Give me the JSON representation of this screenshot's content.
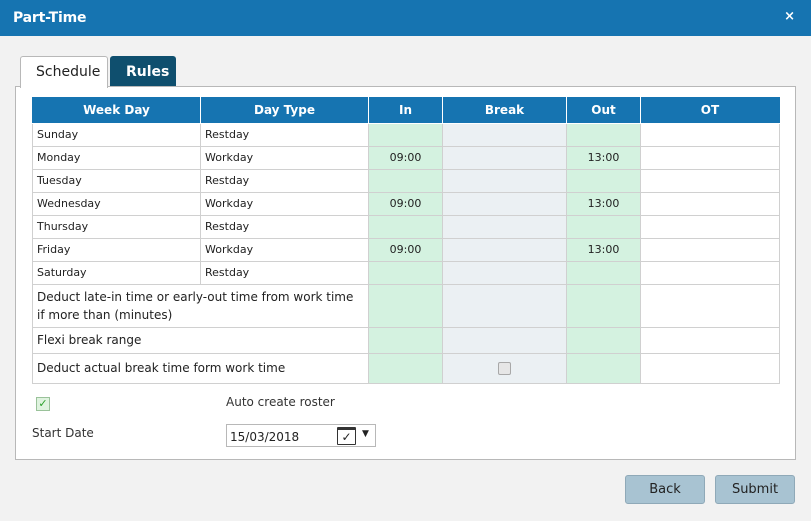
{
  "window": {
    "title": "Part-Time",
    "close_glyph": "×"
  },
  "tabs": [
    {
      "label": "Schedule",
      "active": true
    },
    {
      "label": "Rules",
      "active": false
    }
  ],
  "table": {
    "headers": [
      "Week Day",
      "Day Type",
      "In",
      "Break",
      "Out",
      "OT"
    ],
    "rows": [
      {
        "day": "Sunday",
        "type": "Restday",
        "in": "",
        "out": ""
      },
      {
        "day": "Monday",
        "type": "Workday",
        "in": "09:00",
        "out": "13:00"
      },
      {
        "day": "Tuesday",
        "type": "Restday",
        "in": "",
        "out": ""
      },
      {
        "day": "Wednesday",
        "type": "Workday",
        "in": "09:00",
        "out": "13:00"
      },
      {
        "day": "Thursday",
        "type": "Restday",
        "in": "",
        "out": ""
      },
      {
        "day": "Friday",
        "type": "Workday",
        "in": "09:00",
        "out": "13:00"
      },
      {
        "day": "Saturday",
        "type": "Restday",
        "in": "",
        "out": ""
      }
    ],
    "deduct_late_label": "Deduct late-in time or early-out time from work time if more than (minutes)",
    "flexi_break_label": "Flexi break range",
    "deduct_break_label": "Deduct actual break time form work time"
  },
  "auto_roster": {
    "label": "Auto create roster",
    "checked": true,
    "check_glyph": "✓"
  },
  "start_date": {
    "label": "Start Date",
    "value": "15/03/2018",
    "calendar_glyph": "✓",
    "dropdown_glyph": "▼"
  },
  "buttons": {
    "back": "Back",
    "submit": "Submit"
  },
  "colors": {
    "header_blue": "#1674b1",
    "in_out_green": "#d4f2e0",
    "break_gray": "#ebf0f3",
    "rules_tab": "#0f4f6e",
    "button": "#a8c3d2"
  }
}
